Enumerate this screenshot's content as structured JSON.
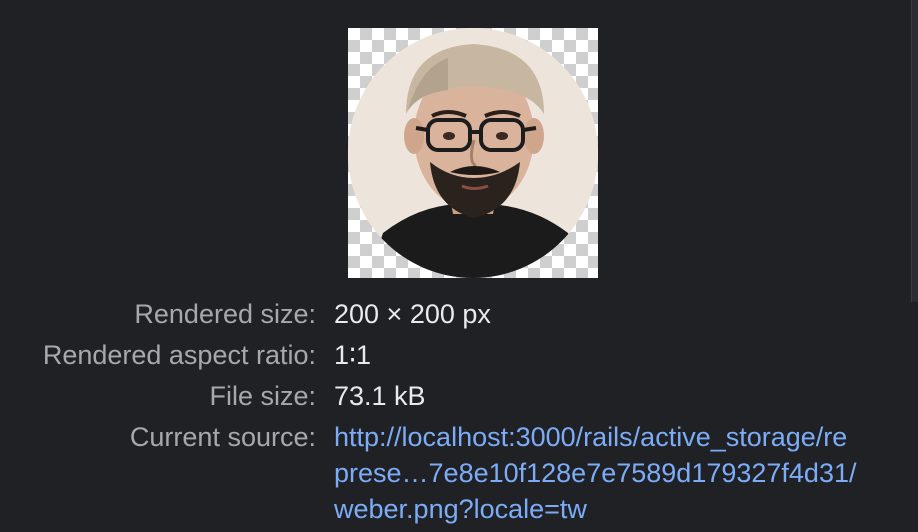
{
  "image_info": {
    "rendered_size": {
      "label": "Rendered size:",
      "value": "200 × 200 px"
    },
    "aspect_ratio": {
      "label": "Rendered aspect ratio:",
      "value": "1∶1"
    },
    "file_size": {
      "label": "File size:",
      "value": "73.1 kB"
    },
    "current_source": {
      "label": "Current source:",
      "lines": [
        "http://localhost:3000/rails/active_storage/re",
        "prese…7e8e10f128e7e7589d179327f4d31/",
        "weber.png?locale=tw"
      ]
    }
  },
  "colors": {
    "background": "#202124",
    "label": "#a5a9ae",
    "value": "#e8eaed",
    "link": "#7cacf8"
  }
}
